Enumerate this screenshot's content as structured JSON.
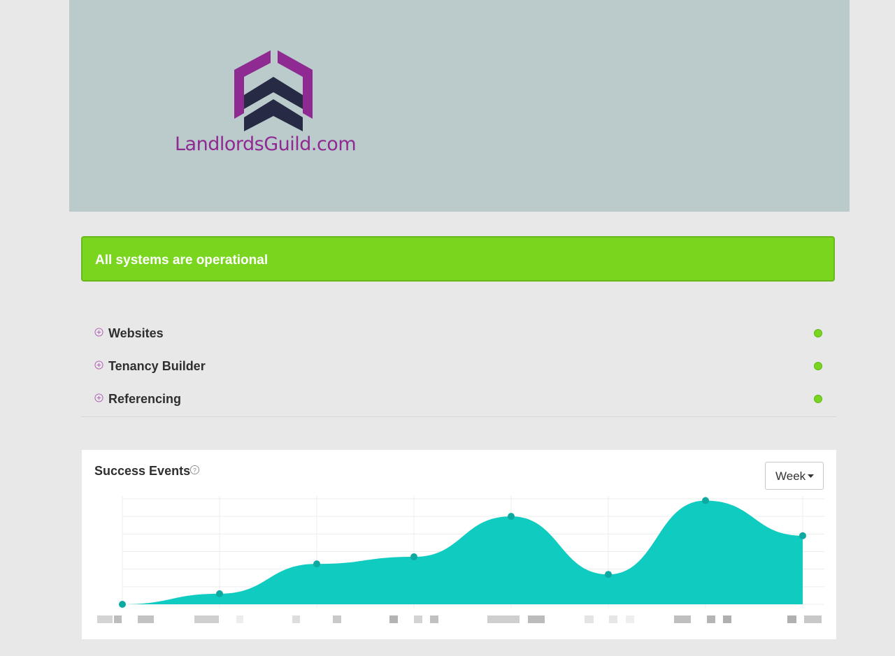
{
  "brand": {
    "logo_text": "LandlordsGuild.com",
    "header_bg": "#bbcbcb",
    "primary_color": "#8e2a92",
    "dark_color": "#262a44"
  },
  "status": {
    "message": "All systems are operational",
    "color": "#7ad51f"
  },
  "components": [
    {
      "name": "Websites",
      "status_color": "#7ad51f",
      "expand_icon": "plus-circle-icon"
    },
    {
      "name": "Tenancy Builder",
      "status_color": "#7ad51f",
      "expand_icon": "plus-circle-icon"
    },
    {
      "name": "Referencing",
      "status_color": "#7ad51f",
      "expand_icon": "plus-circle-icon"
    }
  ],
  "metrics": {
    "title": "Success Events",
    "help_icon": "question-circle-icon",
    "period": "Week",
    "period_icon": "caret-down-icon"
  },
  "chart_data": {
    "type": "area",
    "title": "Success Events",
    "xlabel": "",
    "ylabel": "",
    "x": [
      "",
      "",
      "",
      "",
      "",
      "",
      "",
      ""
    ],
    "values": [
      0,
      6,
      23,
      27,
      50,
      17,
      59,
      39
    ],
    "ylim": [
      0,
      60
    ],
    "grid": true,
    "color": "#0fcbc0",
    "tick_labels_obscured": true
  }
}
